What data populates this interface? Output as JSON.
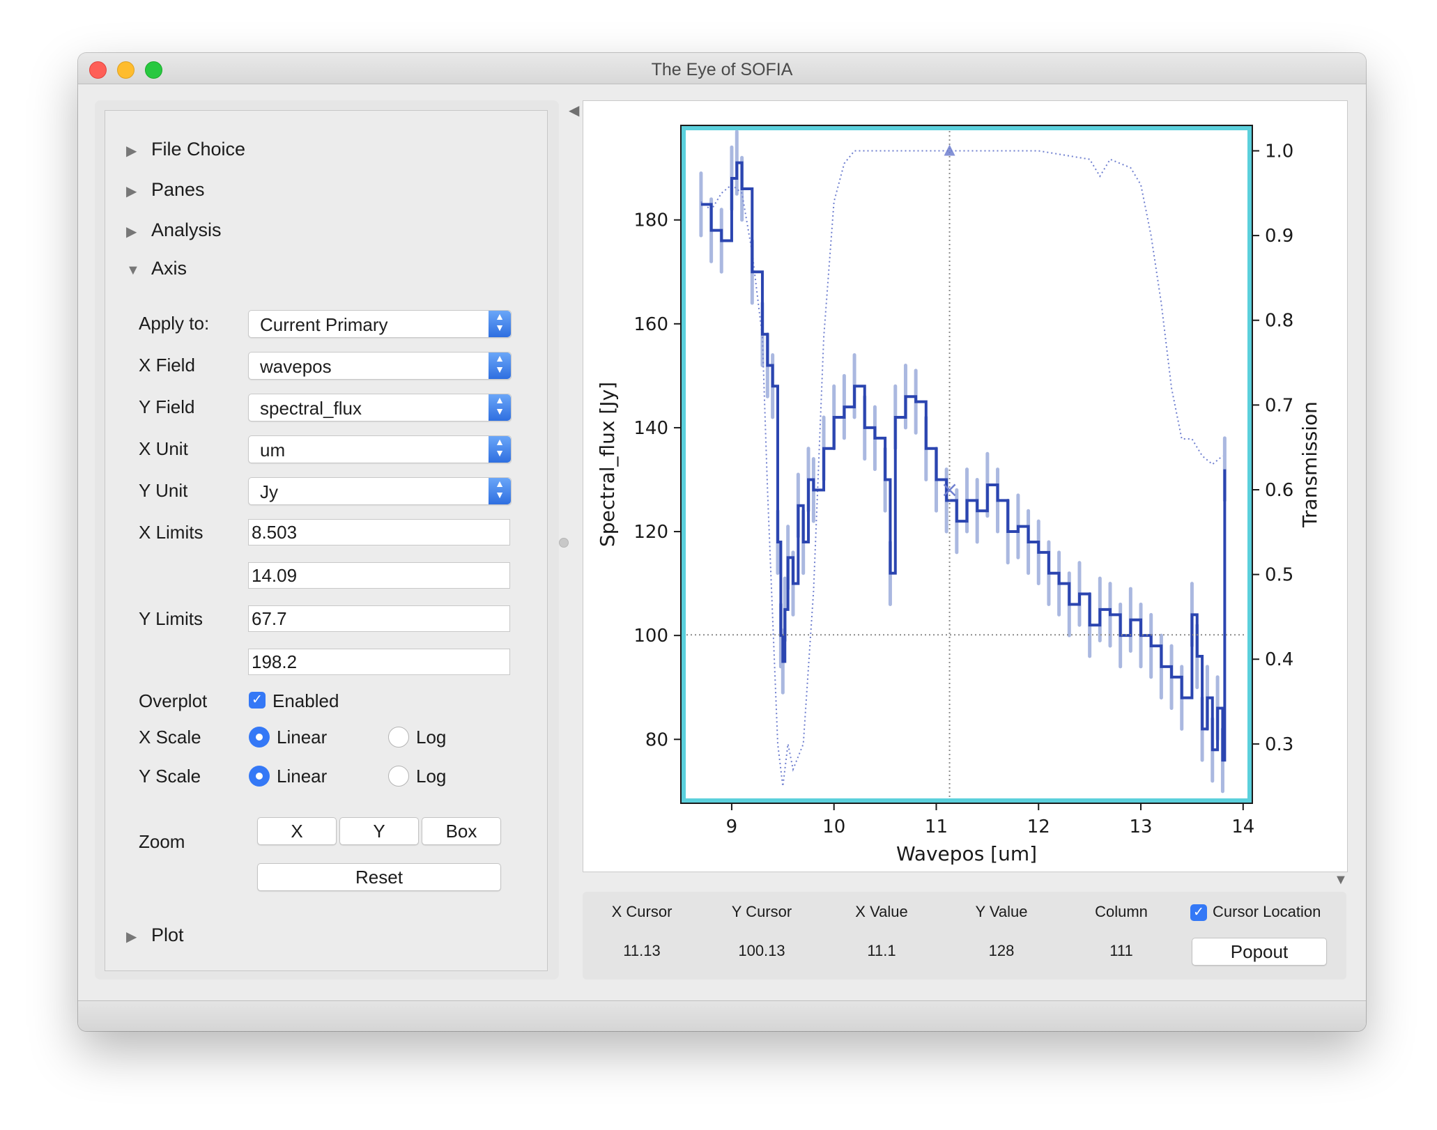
{
  "window": {
    "title": "The Eye of SOFIA"
  },
  "sections": {
    "file_choice": "File Choice",
    "panes": "Panes",
    "analysis": "Analysis",
    "axis": "Axis",
    "plot": "Plot"
  },
  "axis_panel": {
    "apply_to": {
      "label": "Apply to:",
      "value": "Current Primary"
    },
    "x_field": {
      "label": "X Field",
      "value": "wavepos"
    },
    "y_field": {
      "label": "Y Field",
      "value": "spectral_flux"
    },
    "x_unit": {
      "label": "X Unit",
      "value": "um"
    },
    "y_unit": {
      "label": "Y Unit",
      "value": "Jy"
    },
    "x_limits": {
      "label": "X Limits",
      "min": "8.503",
      "max": "14.09"
    },
    "y_limits": {
      "label": "Y Limits",
      "min": "67.7",
      "max": "198.2"
    },
    "overplot": {
      "label": "Overplot",
      "checkbox_label": "Enabled",
      "checked": true
    },
    "x_scale": {
      "label": "X Scale",
      "linear": "Linear",
      "log": "Log",
      "selected": "Linear"
    },
    "y_scale": {
      "label": "Y Scale",
      "linear": "Linear",
      "log": "Log",
      "selected": "Linear"
    },
    "zoom": {
      "label": "Zoom",
      "x": "X",
      "y": "Y",
      "box": "Box",
      "reset": "Reset"
    }
  },
  "cursor_panel": {
    "headers": [
      "X Cursor",
      "Y Cursor",
      "X Value",
      "Y Value",
      "Column"
    ],
    "values": [
      "11.13",
      "100.13",
      "11.1",
      "128",
      "111"
    ],
    "cursor_location": {
      "label": "Cursor Location",
      "checked": true
    },
    "popout": "Popout"
  },
  "colors": {
    "flux": "#2b45b0",
    "flux_error": "#aab8e0",
    "transmission": "#6f7fcf",
    "frame_highlight": "#5bd0dc"
  },
  "chart_data": {
    "type": "line",
    "xlabel": "Wavepos [um]",
    "ylabel": "Spectral_flux [Jy]",
    "y2label": "Transmission",
    "xlim": [
      8.503,
      14.09
    ],
    "ylim": [
      67.7,
      198.2
    ],
    "y2lim": [
      0.23,
      1.03
    ],
    "xticks": [
      9,
      10,
      11,
      12,
      13,
      14
    ],
    "yticks": [
      80,
      100,
      120,
      140,
      160,
      180
    ],
    "y2ticks": [
      0.3,
      0.4,
      0.5,
      0.6,
      0.7,
      0.8,
      0.9,
      1.0
    ],
    "cursor": {
      "x": 11.13,
      "y": 100.13
    },
    "series": [
      {
        "style": "steps",
        "x": [
          8.7,
          8.8,
          8.9,
          9.0,
          9.05,
          9.1,
          9.2,
          9.3,
          9.35,
          9.4,
          9.45,
          9.48,
          9.5,
          9.52,
          9.55,
          9.6,
          9.65,
          9.7,
          9.75,
          9.8,
          9.9,
          10.0,
          10.1,
          10.2,
          10.3,
          10.4,
          10.5,
          10.55,
          10.6,
          10.7,
          10.8,
          10.9,
          11.0,
          11.1,
          11.2,
          11.3,
          11.4,
          11.5,
          11.6,
          11.7,
          11.8,
          11.9,
          12.0,
          12.1,
          12.2,
          12.3,
          12.4,
          12.5,
          12.6,
          12.7,
          12.8,
          12.9,
          13.0,
          13.1,
          13.2,
          13.3,
          13.4,
          13.5,
          13.55,
          13.6,
          13.65,
          13.7,
          13.75,
          13.8,
          13.82
        ],
        "y": [
          183,
          178,
          176,
          188,
          191,
          186,
          170,
          158,
          152,
          148,
          118,
          100,
          95,
          105,
          115,
          110,
          125,
          118,
          130,
          128,
          136,
          142,
          144,
          148,
          140,
          138,
          130,
          112,
          142,
          146,
          145,
          136,
          130,
          126,
          122,
          126,
          124,
          129,
          126,
          120,
          121,
          118,
          116,
          112,
          110,
          106,
          108,
          102,
          105,
          104,
          100,
          103,
          100,
          98,
          94,
          92,
          88,
          104,
          96,
          82,
          88,
          78,
          86,
          76,
          132
        ]
      },
      {
        "style": "dotted",
        "axis": "right",
        "x": [
          8.7,
          8.8,
          8.9,
          9.0,
          9.1,
          9.2,
          9.3,
          9.35,
          9.4,
          9.45,
          9.5,
          9.55,
          9.6,
          9.7,
          9.8,
          9.9,
          10.0,
          10.1,
          10.2,
          10.4,
          10.6,
          11.0,
          11.5,
          12.0,
          12.5,
          12.6,
          12.7,
          12.9,
          13.0,
          13.1,
          13.2,
          13.3,
          13.4,
          13.5,
          13.6,
          13.7,
          13.8
        ],
        "y": [
          0.94,
          0.93,
          0.95,
          0.96,
          0.95,
          0.88,
          0.78,
          0.6,
          0.45,
          0.3,
          0.25,
          0.3,
          0.27,
          0.3,
          0.48,
          0.78,
          0.94,
          0.985,
          1.0,
          1.0,
          1.0,
          1.0,
          1.0,
          1.0,
          0.99,
          0.97,
          0.99,
          0.98,
          0.96,
          0.9,
          0.82,
          0.72,
          0.66,
          0.66,
          0.64,
          0.63,
          0.64
        ]
      }
    ]
  }
}
